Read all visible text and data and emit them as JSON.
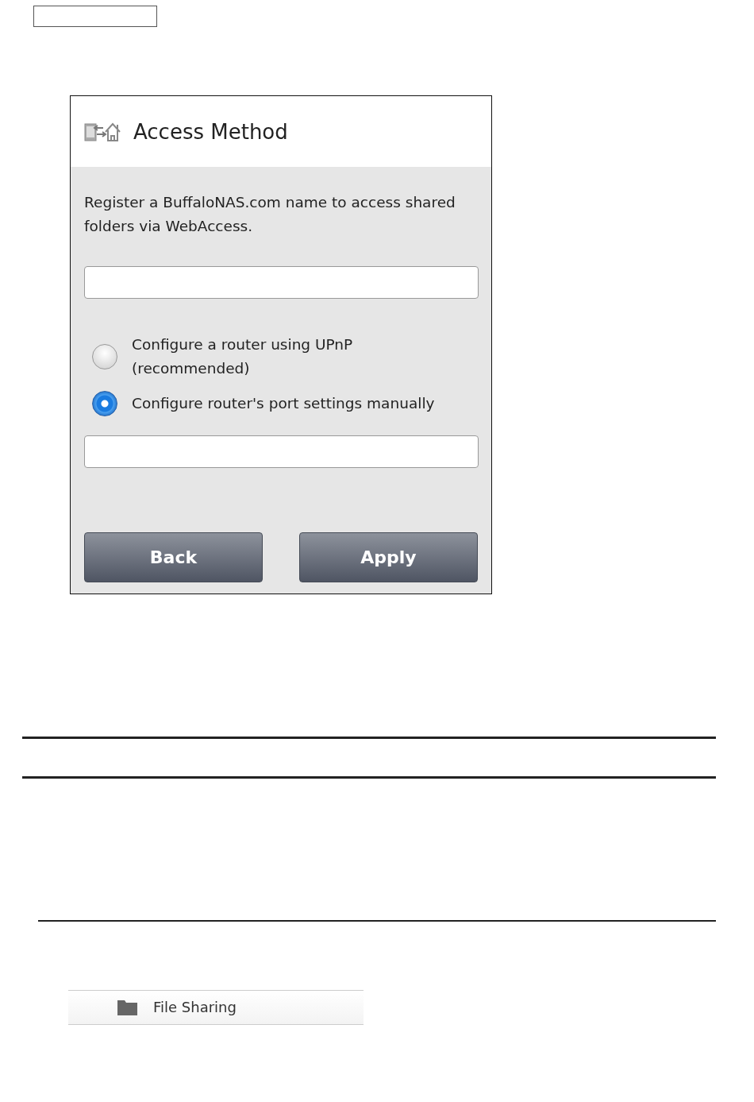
{
  "dialog": {
    "title": "Access Method",
    "description": "Register a BuffaloNAS.com name to access shared folders via WebAccess.",
    "options": [
      {
        "label": "Configure a router using UPnP\n(recommended)",
        "selected": false
      },
      {
        "label": "Configure router's port settings manually",
        "selected": true
      }
    ],
    "buttons": [
      "Back",
      "Apply"
    ]
  },
  "menu_item": {
    "label": "File Sharing"
  }
}
